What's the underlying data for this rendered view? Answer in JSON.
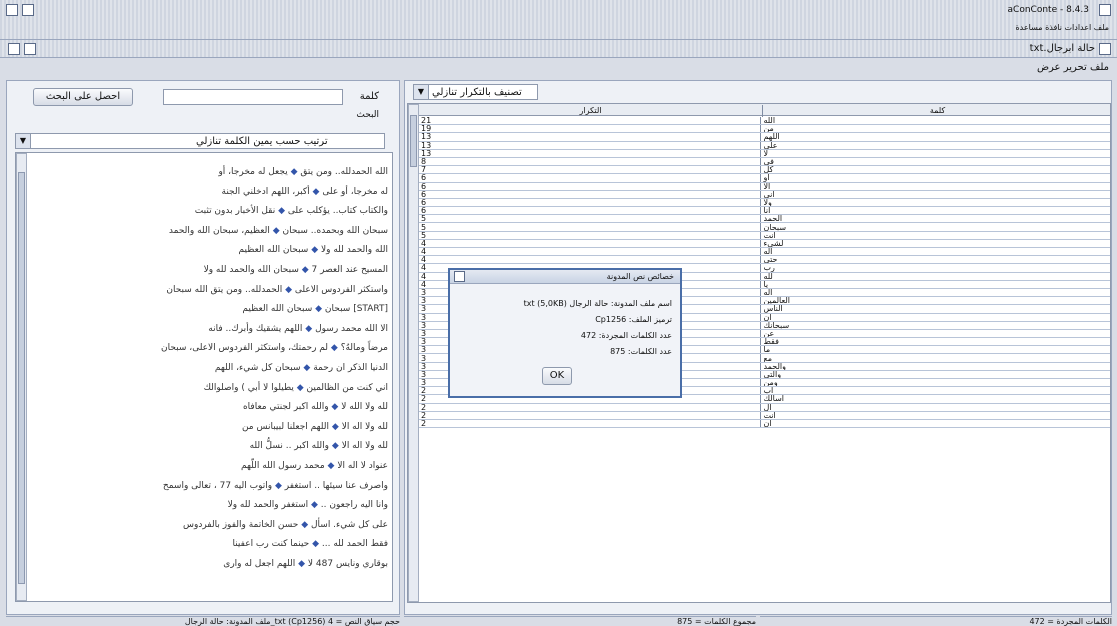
{
  "app": {
    "title": "aConConte - 8.4.3",
    "menu": [
      "ملف",
      "اعدادات",
      "نافذة",
      "مساعدة"
    ],
    "inner_title": "txt.حالة ابرجال",
    "inner_menu": [
      "ملف",
      "تحرير",
      "عرض"
    ]
  },
  "search": {
    "label": "كلمة",
    "sublabel": "البحث",
    "button": "احصل على البحث",
    "value": ""
  },
  "sort_left": {
    "value": "ترتيب حسب يمين الكلمة تنازلي"
  },
  "sort_right": {
    "value": "تصنيف بالتكرار تنازلي"
  },
  "table": {
    "headers": {
      "word": "كلمة",
      "count": "التكرار"
    },
    "rows": [
      {
        "c": "21",
        "w": "الله"
      },
      {
        "c": "19",
        "w": "من"
      },
      {
        "c": "13",
        "w": "اللهم"
      },
      {
        "c": "13",
        "w": "على"
      },
      {
        "c": "13",
        "w": "لا"
      },
      {
        "c": "8",
        "w": "في"
      },
      {
        "c": "7",
        "w": "كل"
      },
      {
        "c": "6",
        "w": "او"
      },
      {
        "c": "6",
        "w": "الا"
      },
      {
        "c": "6",
        "w": "اني"
      },
      {
        "c": "6",
        "w": "ولا"
      },
      {
        "c": "6",
        "w": "انا"
      },
      {
        "c": "5",
        "w": "الحمد"
      },
      {
        "c": "5",
        "w": "سبحان"
      },
      {
        "c": "5",
        "w": "انت"
      },
      {
        "c": "4",
        "w": "لشيء"
      },
      {
        "c": "4",
        "w": "اله"
      },
      {
        "c": "4",
        "w": "حتى"
      },
      {
        "c": "4",
        "w": "رب"
      },
      {
        "c": "4",
        "w": "لله"
      },
      {
        "c": "4",
        "w": "يا"
      },
      {
        "c": "3",
        "w": "اله"
      },
      {
        "c": "3",
        "w": "العالمين"
      },
      {
        "c": "3",
        "w": "الناس"
      },
      {
        "c": "3",
        "w": "ان"
      },
      {
        "c": "3",
        "w": "سبحانك"
      },
      {
        "c": "3",
        "w": "عن"
      },
      {
        "c": "3",
        "w": "فقط"
      },
      {
        "c": "3",
        "w": "ما"
      },
      {
        "c": "3",
        "w": "مع"
      },
      {
        "c": "3",
        "w": "والحمد"
      },
      {
        "c": "3",
        "w": "والتي"
      },
      {
        "c": "3",
        "w": "ومن"
      },
      {
        "c": "2",
        "w": "اب"
      },
      {
        "c": "2",
        "w": "اسالك"
      },
      {
        "c": "2",
        "w": "ال"
      },
      {
        "c": "2",
        "w": "انت"
      },
      {
        "c": "2",
        "w": "ان"
      }
    ]
  },
  "results": [
    {
      "r": "يجعل له مخرجا، أو",
      "l": "الله الحمدلله.. ومن يتق"
    },
    {
      "r": "أكبر، اللهم ادخلني الجنة",
      "l": "له مخرجا، أو على"
    },
    {
      "r": "نقل الأخبار بدون تثبت",
      "l": "والكتاب كتاب.. يؤكلب على"
    },
    {
      "r": "العظيم، سبحان الله والحمد",
      "l": "سبحان الله وبحمده.. سبحان"
    },
    {
      "r": "سبحان الله العظيم",
      "l": "الله والحمد لله ولا"
    },
    {
      "r": "سبحان الله والحمد لله ولا",
      "l": "المسيح عند العصر 7"
    },
    {
      "r": "الحمدلله.. ومن يتق الله سبحان",
      "l": "واستكثر الفردوس الاعلى"
    },
    {
      "r": "سبحان الله العظيم",
      "l": "[START] سبحان"
    },
    {
      "r": "اللهم يشقيك وأبرك.. فانه",
      "l": "الا الله محمد رسول"
    },
    {
      "r": "لم رحمتك، واستكثر الفردوس الاعلى، سبحان",
      "l": "مرضاً ومالهُ؟"
    },
    {
      "r": "سبحان كل شيء، اللهم",
      "l": "الدنيا الذكر ان رحمة"
    },
    {
      "r": "يطيلوا لا أبي ) واصلوالك",
      "l": "اني كنت من الظالمين"
    },
    {
      "r": "والله اكبر لجنتي معافاه",
      "l": "لله ولا الله لا"
    },
    {
      "r": "اللهم اجعلنا لبيبانس من",
      "l": "لله ولا اله الا"
    },
    {
      "r": "والله اكبر .. نسلُّ الله",
      "l": "لله ولا اله الا"
    },
    {
      "r": "محمد رسول الله اللّهم",
      "l": "عنواد لا اله الا"
    },
    {
      "r": "واتوب اليه 77 ، تعالى واسمح",
      "l": "واصرف عنا سيئها .. استغفر"
    },
    {
      "r": "استغفر والحمد لله ولا",
      "l": "وانا اليه راجعون .."
    },
    {
      "r": "حسن الخاتمة والفوز بالفردوس",
      "l": "على كل شيء. اسأل"
    },
    {
      "r": "حينما كنت رب اعفينا",
      "l": "فقط الحمد لله ..."
    },
    {
      "r": "اللهم اجعل له وارى",
      "l": "بوقاري ونايس 487 لا"
    }
  ],
  "dialog": {
    "title": "خصائص نص المدونة",
    "lines": [
      "اسم ملف المدونة: حالة الرجال (txt (5,0KB",
      "ترميز الملف: Cp1256",
      "عدد الكلمات المجردة: 472",
      "عدد الكلمات: 875"
    ],
    "ok": "OK"
  },
  "status": {
    "left": "ملف المدونة: حالة الرجال_txt (Cp1256) حجم سياق النص = 4",
    "middle": "مجموع الكلمات = 875",
    "right": "الكلمات المجردة = 472"
  }
}
